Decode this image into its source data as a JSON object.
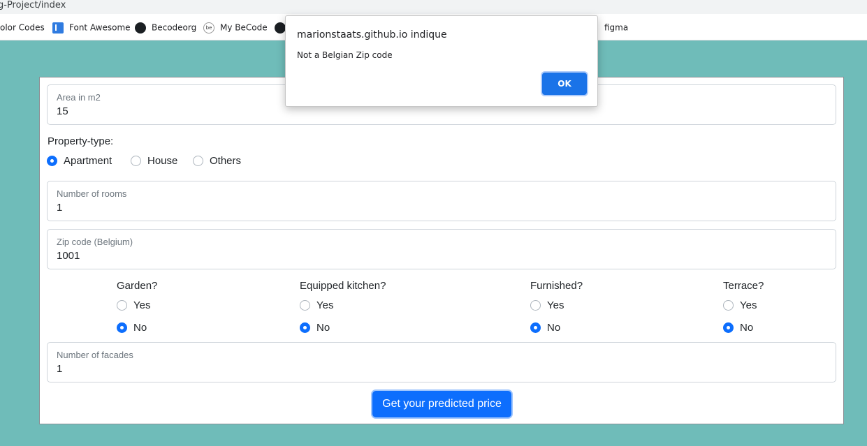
{
  "browser": {
    "url_fragment": "g-Project/index",
    "bookmarks": [
      {
        "label": "olor Codes",
        "icon": "none"
      },
      {
        "label": "Font Awesome",
        "icon": "flag-icon"
      },
      {
        "label": "Becodeorg",
        "icon": "github-icon"
      },
      {
        "label": "My BeCode",
        "icon": "becode-icon"
      },
      {
        "label": "",
        "icon": "github-icon"
      },
      {
        "label": "figma",
        "icon": "none"
      }
    ]
  },
  "dialog": {
    "title": "marionstaats.github.io indique",
    "message": "Not a Belgian Zip code",
    "ok_label": "OK"
  },
  "form": {
    "area": {
      "label": "Area in m2",
      "value": "15"
    },
    "property_type": {
      "label": "Property-type:",
      "options": [
        "Apartment",
        "House",
        "Others"
      ],
      "selected": "Apartment"
    },
    "rooms": {
      "label": "Number of rooms",
      "value": "1"
    },
    "zip": {
      "label": "Zip code (Belgium)",
      "value": "1001"
    },
    "amenities": [
      {
        "title": "Garden?",
        "yes": "Yes",
        "no": "No",
        "selected": "No"
      },
      {
        "title": "Equipped kitchen?",
        "yes": "Yes",
        "no": "No",
        "selected": "No"
      },
      {
        "title": "Furnished?",
        "yes": "Yes",
        "no": "No",
        "selected": "No"
      },
      {
        "title": "Terrace?",
        "yes": "Yes",
        "no": "No",
        "selected": "No"
      }
    ],
    "facades": {
      "label": "Number of facades",
      "value": "1"
    },
    "submit_label": "Get your predicted price"
  },
  "colors": {
    "page_background": "#6fbcb9",
    "primary": "#0d6efd",
    "dialog_button": "#1a73e8"
  }
}
